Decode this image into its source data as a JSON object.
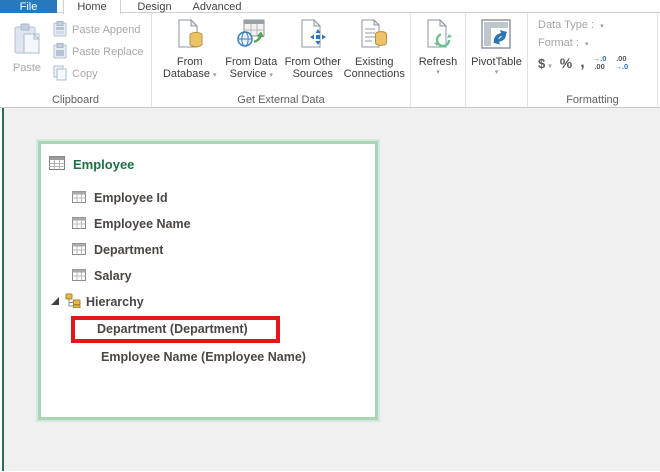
{
  "tabs": {
    "file": "File",
    "home": "Home",
    "design": "Design",
    "advanced": "Advanced"
  },
  "ribbon": {
    "clipboard": {
      "group_label": "Clipboard",
      "paste_label": "Paste",
      "paste_append_label": "Paste Append",
      "paste_replace_label": "Paste Replace",
      "copy_label": "Copy"
    },
    "external": {
      "group_label": "Get External Data",
      "from_database": {
        "line1": "From",
        "line2": "Database"
      },
      "from_data_service": {
        "line1": "From Data",
        "line2": "Service"
      },
      "from_other_sources": {
        "line1": "From Other",
        "line2": "Sources"
      },
      "existing_connections": {
        "line1": "Existing",
        "line2": "Connections"
      }
    },
    "refresh": {
      "label": "Refresh"
    },
    "pivottable": {
      "label": "PivotTable"
    },
    "formatting": {
      "group_label": "Formatting",
      "data_type_label": "Data Type :",
      "format_label": "Format :",
      "currency_label": "$",
      "percent_label": "%",
      "comma_label": ",",
      "increase_decimal_top": "→.0",
      "increase_decimal_bottom": ".00",
      "decrease_decimal_top": ".00",
      "decrease_decimal_bottom": "→.0"
    }
  },
  "diagram": {
    "table_title": "Employee",
    "fields": [
      "Employee Id",
      "Employee Name",
      "Department",
      "Salary"
    ],
    "hierarchy_label": "Hierarchy",
    "children": [
      "Department (Department)",
      "Employee Name (Employee Name)"
    ]
  },
  "icons": {
    "dropdown_caret": "▾"
  },
  "colors": {
    "file_tab_blue": "#2878bd",
    "title_green": "#1e7145",
    "card_border_green": "#a6d7b4",
    "highlight_red": "#e8141c",
    "pane_line_green": "#2a6e54"
  }
}
